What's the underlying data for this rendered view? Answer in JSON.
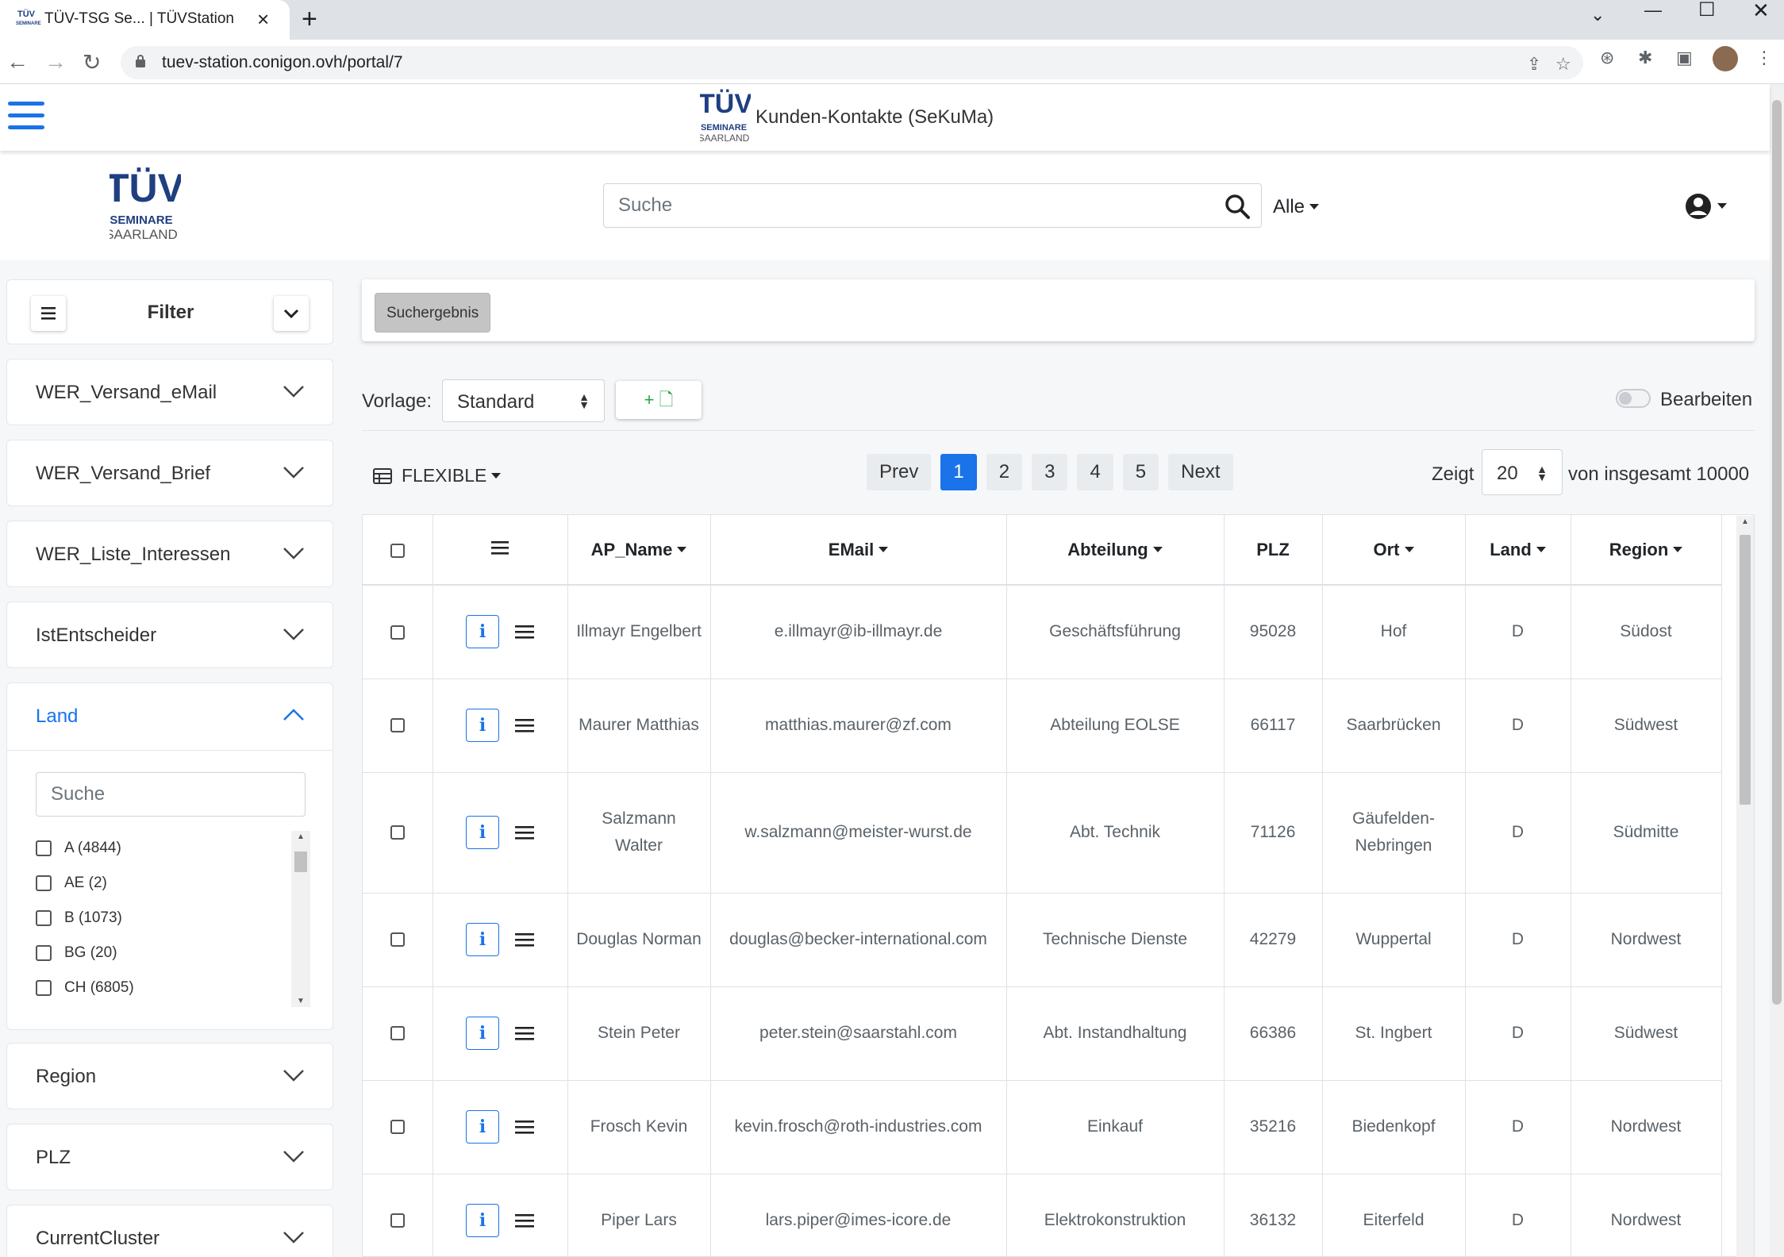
{
  "browser": {
    "tab_title": "TÜV-TSG Se... | TÜVStation",
    "url": "tuev-station.conigon.ovh/portal/7"
  },
  "appbar": {
    "title": "Kunden-Kontakte (SeKuMa)",
    "logo_top": "TÜV",
    "logo_mid": "SEMINARE",
    "logo_bot": "SAARLAND"
  },
  "header": {
    "search_placeholder": "Suche",
    "scope_label": "Alle"
  },
  "sidebar": {
    "filter_title": "Filter",
    "accordions": [
      {
        "label": "WER_Versand_eMail"
      },
      {
        "label": "WER_Versand_Brief"
      },
      {
        "label": "WER_Liste_Interessen"
      },
      {
        "label": "IstEntscheider"
      }
    ],
    "land": {
      "label": "Land",
      "search_placeholder": "Suche",
      "items": [
        "A (4844)",
        "AE (2)",
        "B (1073)",
        "BG (20)",
        "CH (6805)"
      ]
    },
    "accordions_after": [
      {
        "label": "Region"
      },
      {
        "label": "PLZ"
      },
      {
        "label": "CurrentCluster"
      }
    ]
  },
  "main": {
    "breadcrumb": "Suchergebnis",
    "vorlage_label": "Vorlage:",
    "vorlage_value": "Standard",
    "add_template": "+ 🗋",
    "edit_label": "Bearbeiten",
    "view_label": "FLEXIBLE",
    "pager": {
      "prev": "Prev",
      "pages": [
        "1",
        "2",
        "3",
        "4",
        "5"
      ],
      "active": "1",
      "next": "Next"
    },
    "zeigt_label": "Zeigt",
    "page_size": "20",
    "total_label": "von insgesamt 10000"
  },
  "table": {
    "headers": [
      "AP_Name",
      "EMail",
      "Abteilung",
      "PLZ",
      "Ort",
      "Land",
      "Region"
    ],
    "rows": [
      {
        "name": "Illmayr Engelbert",
        "email": "e.illmayr@ib-illmayr.de",
        "abteilung": "Geschäftsführung",
        "plz": "95028",
        "ort": "Hof",
        "land": "D",
        "region": "Südost"
      },
      {
        "name": "Maurer Matthias",
        "email": "matthias.maurer@zf.com",
        "abteilung": "Abteilung EOLSE",
        "plz": "66117",
        "ort": "Saarbrücken",
        "land": "D",
        "region": "Südwest"
      },
      {
        "name": "Salzmann Walter",
        "email": "w.salzmann@meister-wurst.de",
        "abteilung": "Abt. Technik",
        "plz": "71126",
        "ort": "Gäufelden-Nebringen",
        "land": "D",
        "region": "Südmitte"
      },
      {
        "name": "Douglas Norman",
        "email": "douglas@becker-international.com",
        "abteilung": "Technische Dienste",
        "plz": "42279",
        "ort": "Wuppertal",
        "land": "D",
        "region": "Nordwest"
      },
      {
        "name": "Stein Peter",
        "email": "peter.stein@saarstahl.com",
        "abteilung": "Abt. Instandhaltung",
        "plz": "66386",
        "ort": "St. Ingbert",
        "land": "D",
        "region": "Südwest"
      },
      {
        "name": "Frosch Kevin",
        "email": "kevin.frosch@roth-industries.com",
        "abteilung": "Einkauf",
        "plz": "35216",
        "ort": "Biedenkopf",
        "land": "D",
        "region": "Nordwest"
      },
      {
        "name": "Piper Lars",
        "email": "lars.piper@imes-icore.de",
        "abteilung": "Elektrokonstruktion",
        "plz": "36132",
        "ort": "Eiterfeld",
        "land": "D",
        "region": "Nordwest"
      }
    ]
  },
  "colors": {
    "accent": "#1a73e8",
    "success": "#28a745",
    "logo": "#1f3f80"
  }
}
